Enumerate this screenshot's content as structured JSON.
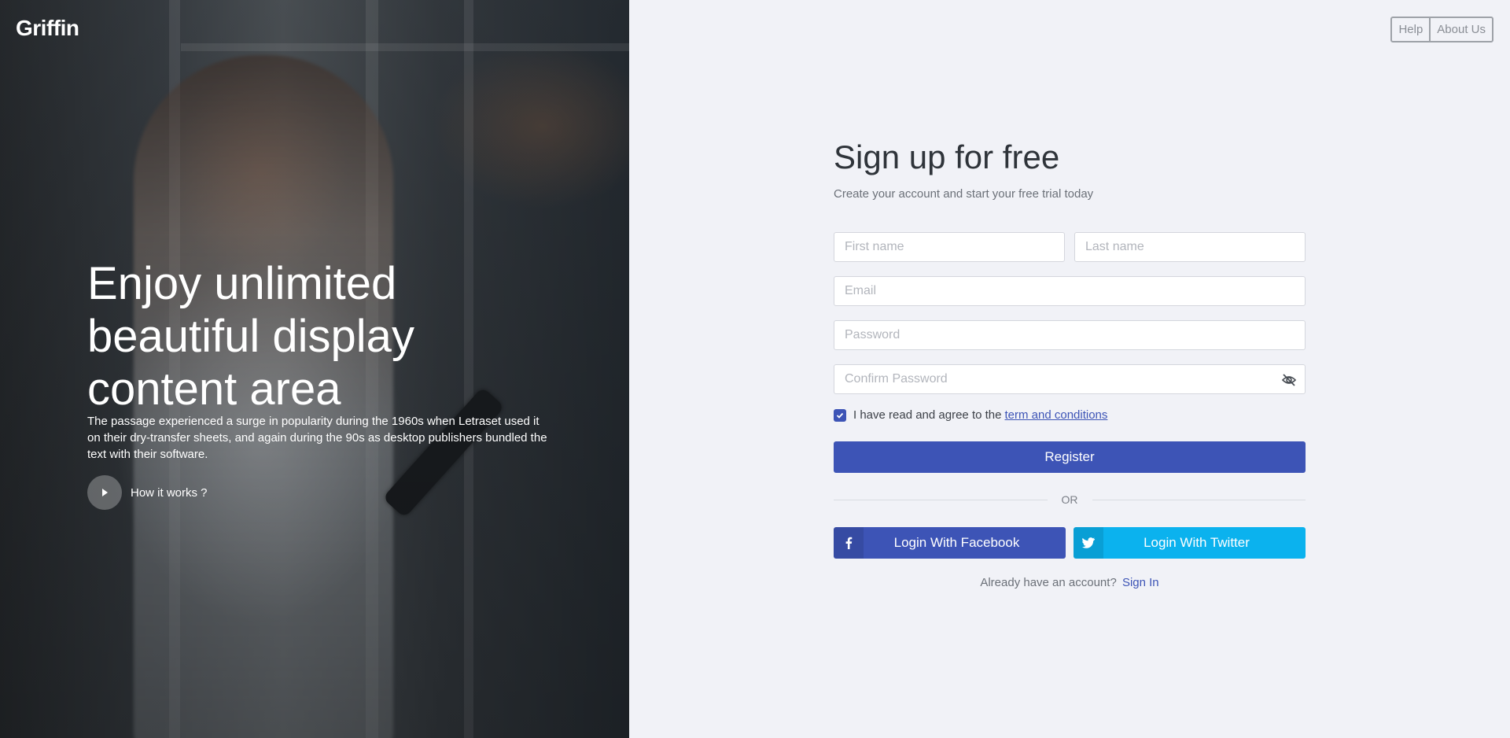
{
  "brand": {
    "logo": "Griffin"
  },
  "hero": {
    "title_lines": [
      "Enjoy unlimited",
      "beautiful display",
      "content area"
    ],
    "description": "The passage experienced a surge in popularity during the 1960s when Letraset used it on their dry-transfer sheets, and again during the 90s as desktop publishers bundled the text with their software.",
    "how_it_works": "How it works ?"
  },
  "nav": {
    "help": "Help",
    "about": "About Us"
  },
  "form": {
    "title": "Sign up for free",
    "subtitle": "Create your account and start your free trial today",
    "first_name_placeholder": "First name",
    "last_name_placeholder": "Last name",
    "email_placeholder": "Email",
    "password_placeholder": "Password",
    "confirm_password_placeholder": "Confirm Password",
    "agree_text": "I have read and agree to the",
    "agree_link": "term and conditions",
    "agree_checked": true,
    "register": "Register",
    "or": "OR",
    "facebook": "Login With Facebook",
    "twitter": "Login With Twitter",
    "have_account": "Already have an account?",
    "sign_in": "Sign In"
  },
  "colors": {
    "primary": "#3d54b6",
    "twitter": "#0bb2ee",
    "page_bg": "#f1f2f7"
  }
}
